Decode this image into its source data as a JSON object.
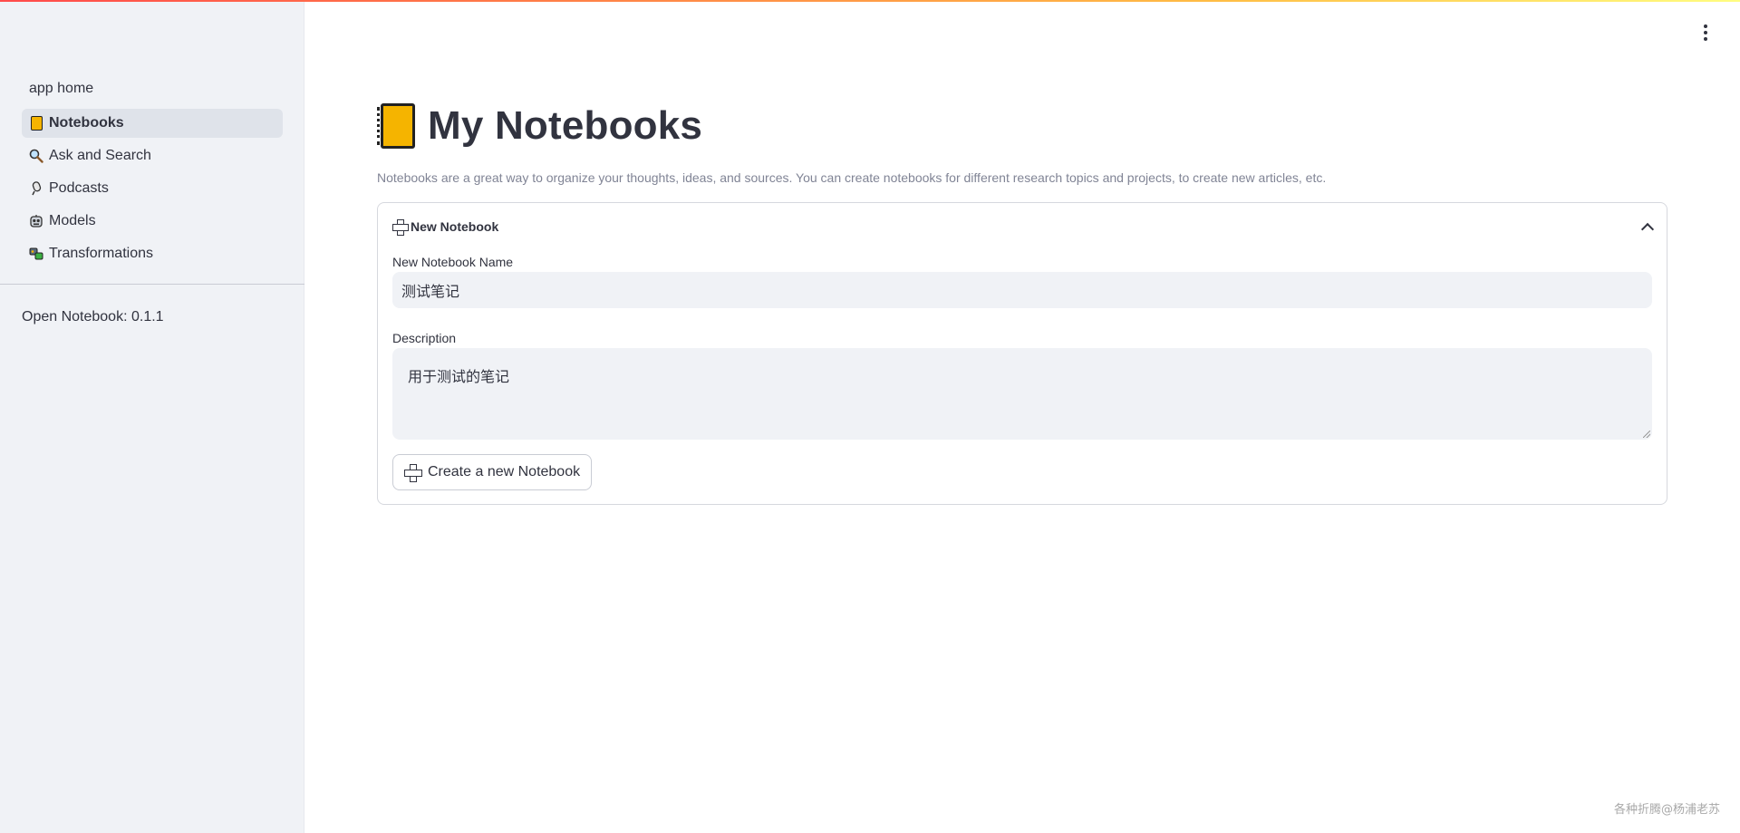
{
  "sidebar": {
    "home_label": "app home",
    "items": [
      {
        "label": "Notebooks",
        "icon": "notebook-icon",
        "active": true
      },
      {
        "label": "Ask and Search",
        "icon": "magnifier-icon",
        "active": false
      },
      {
        "label": "Podcasts",
        "icon": "microphone-icon",
        "active": false
      },
      {
        "label": "Models",
        "icon": "robot-face-icon",
        "active": false
      },
      {
        "label": "Transformations",
        "icon": "transform-icon",
        "active": false
      }
    ],
    "version_text": "Open Notebook: 0.1.1"
  },
  "header": {
    "menu_icon": "kebab-menu-icon"
  },
  "main": {
    "title": "My Notebooks",
    "title_icon": "notebook-icon",
    "subtitle": "Notebooks are a great way to organize your thoughts, ideas, and sources. You can create notebooks for different research topics and projects, to create new articles, etc.",
    "expander": {
      "header_label": "New Notebook",
      "expanded": true,
      "name_label": "New Notebook Name",
      "name_value": "测试笔记",
      "description_label": "Description",
      "description_value": "用于测试的笔记",
      "create_button_label": "Create a new Notebook"
    }
  },
  "watermark": "各种折腾@杨浦老苏",
  "colors": {
    "sidebar_bg": "#f0f2f6",
    "active_item_bg": "#dfe3ea",
    "text": "#31333f",
    "muted_text": "#808495",
    "accent_gradient_start": "#ff4b4b",
    "accent_gradient_end": "#fffd80",
    "notebook_yellow": "#f5b400"
  }
}
